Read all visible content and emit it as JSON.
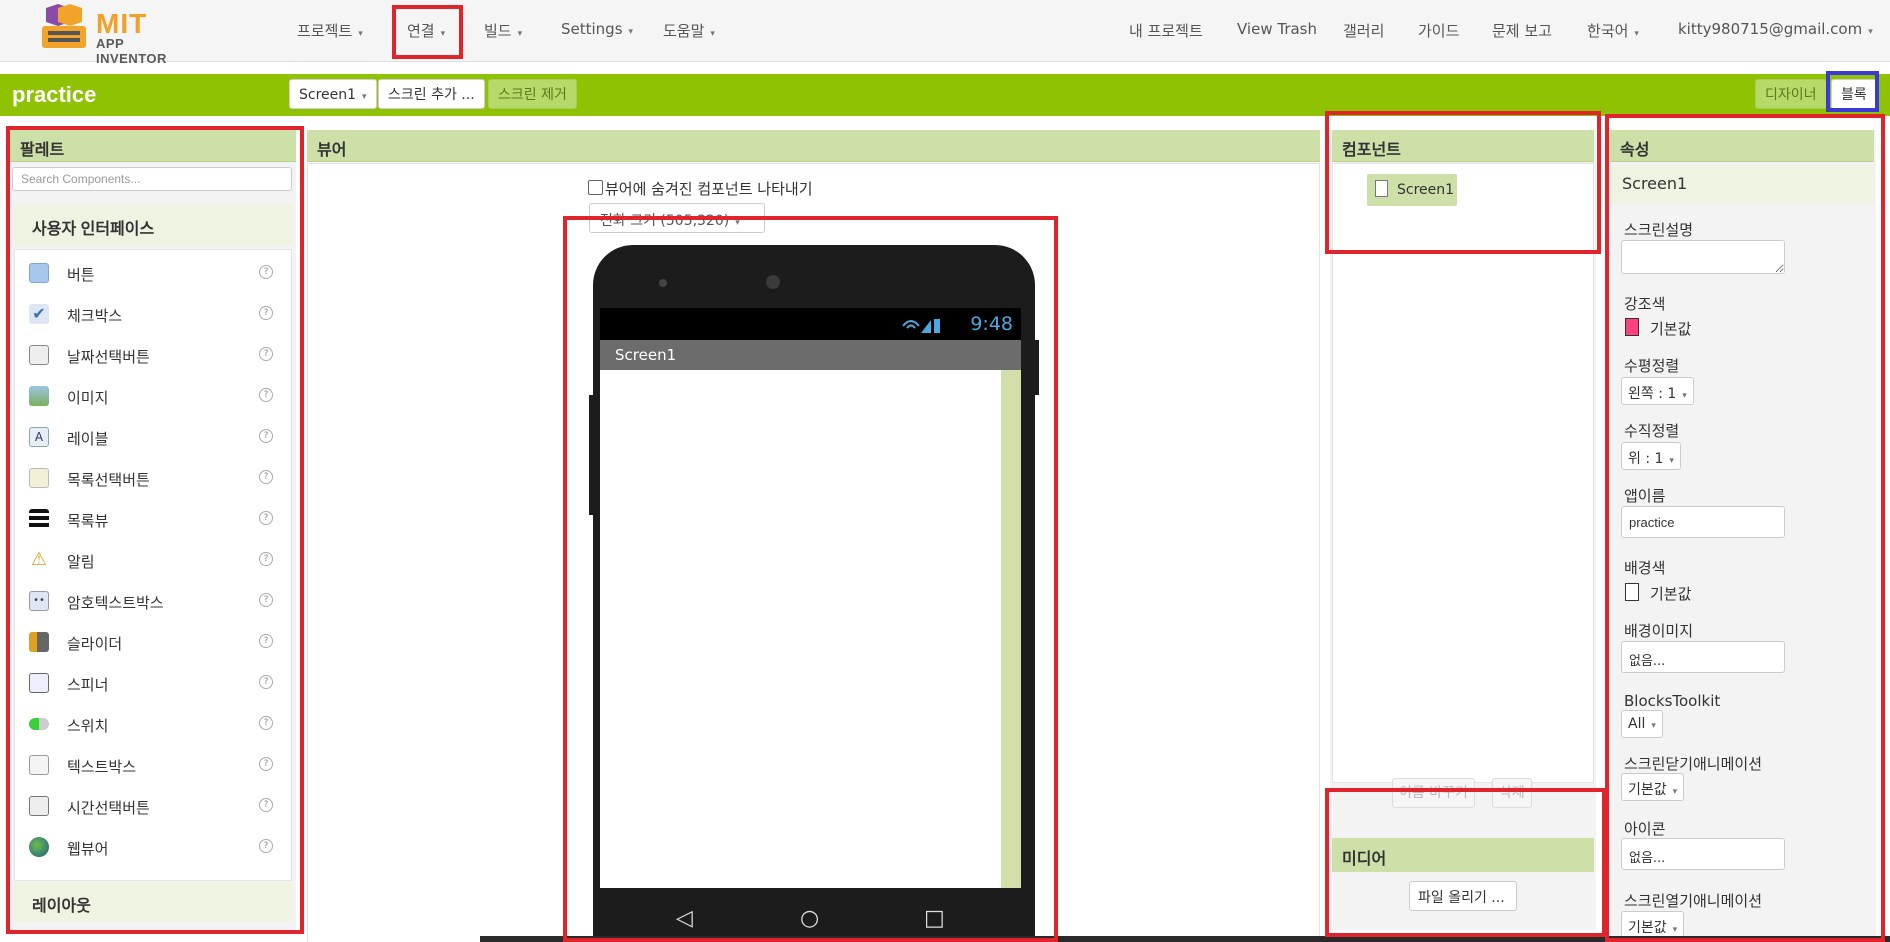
{
  "brand": {
    "line1": "MIT",
    "line2": "APP INVENTOR"
  },
  "nav": {
    "project": "프로젝트",
    "connect": "연결",
    "build": "빌드",
    "settings": "Settings",
    "help": "도움말",
    "my_projects": "내 프로젝트",
    "view_trash": "View Trash",
    "gallery": "갤러리",
    "guide": "가이드",
    "report": "문제 보고",
    "language": "한국어",
    "account": "kitty980715@gmail.com"
  },
  "toolbar": {
    "project_name": "practice",
    "screen_select": "Screen1",
    "add_screen": "스크린 추가 ...",
    "remove_screen": "스크린 제거",
    "designer": "디자이너",
    "blocks": "블록"
  },
  "palette": {
    "title": "팔레트",
    "search_placeholder": "Search Components...",
    "category_ui": "사용자 인터페이스",
    "category_layout": "레이아웃",
    "items": [
      {
        "label": "버튼",
        "icon": "button-icon"
      },
      {
        "label": "체크박스",
        "icon": "checkbox-icon"
      },
      {
        "label": "날짜선택버튼",
        "icon": "datepicker-icon"
      },
      {
        "label": "이미지",
        "icon": "image-icon"
      },
      {
        "label": "레이블",
        "icon": "label-icon"
      },
      {
        "label": "목록선택버튼",
        "icon": "listpicker-icon"
      },
      {
        "label": "목록뷰",
        "icon": "listview-icon"
      },
      {
        "label": "알림",
        "icon": "notifier-icon"
      },
      {
        "label": "암호텍스트박스",
        "icon": "passwordtextbox-icon"
      },
      {
        "label": "슬라이더",
        "icon": "slider-icon"
      },
      {
        "label": "스피너",
        "icon": "spinner-icon"
      },
      {
        "label": "스위치",
        "icon": "switch-icon"
      },
      {
        "label": "텍스트박스",
        "icon": "textbox-icon"
      },
      {
        "label": "시간선택버튼",
        "icon": "timepicker-icon"
      },
      {
        "label": "웹뷰어",
        "icon": "webviewer-icon"
      }
    ],
    "help_glyph": "?"
  },
  "viewer": {
    "title": "뷰어",
    "show_hidden_label": "뷰어에 숨겨진 컴포넌트 나타내기",
    "size_select": "전화 크기 (505,320)",
    "phone": {
      "time": "9:48",
      "screen_title": "Screen1"
    }
  },
  "components": {
    "title": "컴포넌트",
    "tree_root": "Screen1",
    "rename": "이름 바꾸기",
    "delete": "삭제",
    "media_title": "미디어",
    "upload": "파일 올리기 ..."
  },
  "properties": {
    "title": "속성",
    "component": "Screen1",
    "about_screen_label": "스크린설명",
    "accent_color_label": "강조색",
    "accent_color_value": "기본값",
    "align_h_label": "수평정렬",
    "align_h_value": "왼쪽 : 1",
    "align_v_label": "수직정렬",
    "align_v_value": "위 : 1",
    "app_name_label": "앱이름",
    "app_name_value": "practice",
    "bg_color_label": "배경색",
    "bg_color_value": "기본값",
    "bg_image_label": "배경이미지",
    "bg_image_value": "없음...",
    "blocks_toolkit_label": "BlocksToolkit",
    "blocks_toolkit_value": "All",
    "close_anim_label": "스크린닫기애니메이션",
    "close_anim_value": "기본값",
    "icon_label": "아이콘",
    "icon_value": "없음...",
    "open_anim_label": "스크린열기애니메이션",
    "open_anim_value": "기본값"
  },
  "colors": {
    "accent": "#8fc202",
    "accent_swatch": "#ff4081",
    "highlight_red": "#e0242c",
    "highlight_blue": "#3a3ad4"
  }
}
